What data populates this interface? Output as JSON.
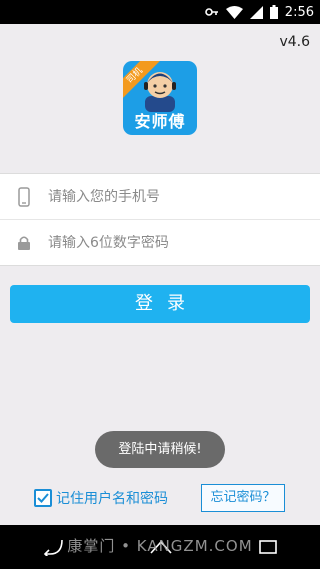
{
  "status_bar": {
    "time": "2:56",
    "icons": [
      "vpn-key-icon",
      "wifi-icon",
      "signal-icon",
      "battery-icon"
    ]
  },
  "app": {
    "version": "v4.6",
    "logo_text": "安师傅",
    "logo_tag": "司机"
  },
  "form": {
    "phone_placeholder": "请输入您的手机号",
    "password_placeholder": "请输入6位数字密码"
  },
  "login_label": "登录",
  "toast": "登陆中请稍候!",
  "remember_label": "记住用户名和密码",
  "remember_checked": true,
  "forgot_label": "忘记密码？",
  "watermark": "康掌门 • KANGZM.COM",
  "colors": {
    "accent": "#1fb2f0",
    "link": "#1a8ed6",
    "logo_bg": "#1d9ee6",
    "logo_tag": "#f39a1e",
    "background": "#eeecef"
  }
}
